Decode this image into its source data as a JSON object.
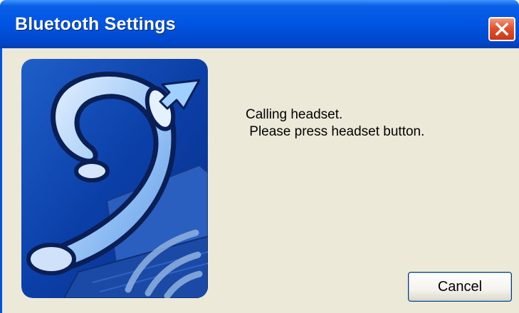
{
  "window": {
    "title": "Bluetooth Settings"
  },
  "message": {
    "line1": "Calling headset.",
    "line2": " Please press headset button."
  },
  "buttons": {
    "cancel_label": "Cancel"
  },
  "icons": {
    "close": "close-icon",
    "illustration": "bluetooth-headset-illustration"
  },
  "colors": {
    "titlebar": "#0054e3",
    "client_background": "#ece9d8",
    "close_button": "#e2512e"
  }
}
